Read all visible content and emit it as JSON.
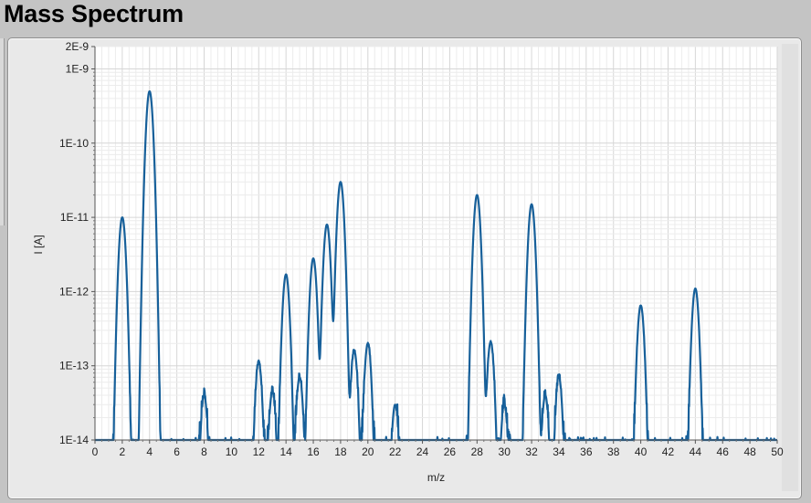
{
  "window": {
    "title": "Mass Spectrum"
  },
  "colors": {
    "trace": "#17609a",
    "plot_bg": "#ffffff",
    "grid_major": "#d6d6d6",
    "grid_minor": "#ececec",
    "panel": "#e9e9e9",
    "background": "#c4c4c4"
  },
  "chart_data": {
    "type": "line",
    "title": "",
    "xlabel": "m/z",
    "ylabel": "I [A]",
    "xlim": [
      0,
      50
    ],
    "ylim": [
      1e-14,
      2e-09
    ],
    "y_scale": "log",
    "grid": true,
    "x_ticks": [
      "0",
      "2",
      "4",
      "6",
      "8",
      "10",
      "12",
      "14",
      "16",
      "18",
      "20",
      "22",
      "24",
      "26",
      "28",
      "30",
      "32",
      "34",
      "36",
      "38",
      "40",
      "42",
      "44",
      "46",
      "48",
      "50"
    ],
    "y_ticks": [
      "1E-14",
      "1E-13",
      "1E-12",
      "1E-11",
      "1E-10",
      "1E-9",
      "2E-9"
    ],
    "peaks": [
      {
        "mz": 2,
        "intensity": 1e-11
      },
      {
        "mz": 4,
        "intensity": 5e-10
      },
      {
        "mz": 8,
        "intensity": 4e-14
      },
      {
        "mz": 12,
        "intensity": 1.1e-13
      },
      {
        "mz": 13,
        "intensity": 4.5e-14
      },
      {
        "mz": 14,
        "intensity": 1.7e-12
      },
      {
        "mz": 15,
        "intensity": 7e-14
      },
      {
        "mz": 16,
        "intensity": 2.8e-12
      },
      {
        "mz": 17,
        "intensity": 8e-12
      },
      {
        "mz": 18,
        "intensity": 3e-11
      },
      {
        "mz": 19,
        "intensity": 1.6e-13
      },
      {
        "mz": 20,
        "intensity": 2e-13
      },
      {
        "mz": 22,
        "intensity": 3e-14
      },
      {
        "mz": 28,
        "intensity": 2e-11
      },
      {
        "mz": 29,
        "intensity": 2.1e-13
      },
      {
        "mz": 30,
        "intensity": 3e-14
      },
      {
        "mz": 32,
        "intensity": 1.5e-11
      },
      {
        "mz": 33,
        "intensity": 4e-14
      },
      {
        "mz": 34,
        "intensity": 7e-14
      },
      {
        "mz": 40,
        "intensity": 6.5e-13
      },
      {
        "mz": 44,
        "intensity": 1.1e-12
      }
    ]
  }
}
